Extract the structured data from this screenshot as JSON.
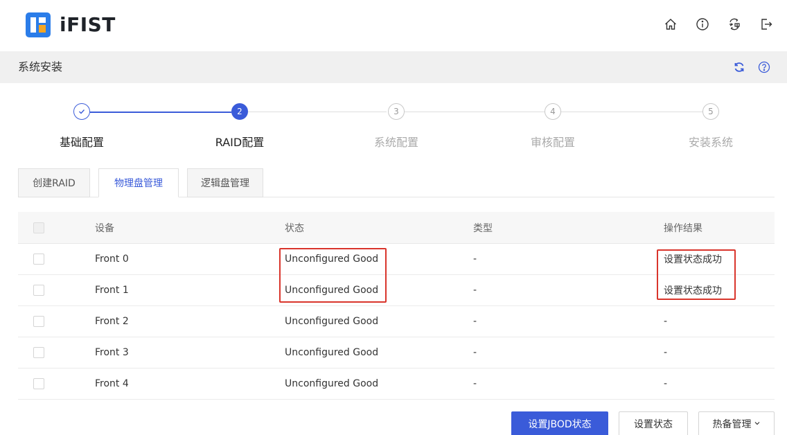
{
  "app": {
    "brand": "iFIST"
  },
  "header": {
    "icons": [
      "home-icon",
      "info-icon",
      "language-switch-icon",
      "logout-icon"
    ]
  },
  "page": {
    "title": "系统安装",
    "toolbar_icons": [
      "refresh-icon",
      "help-icon"
    ]
  },
  "steps": [
    {
      "number": "",
      "label": "基础配置",
      "status": "done"
    },
    {
      "number": "2",
      "label": "RAID配置",
      "status": "current"
    },
    {
      "number": "3",
      "label": "系统配置",
      "status": "pending"
    },
    {
      "number": "4",
      "label": "审核配置",
      "status": "pending"
    },
    {
      "number": "5",
      "label": "安装系统",
      "status": "pending"
    }
  ],
  "tabs": [
    {
      "label": "创建RAID",
      "active": false
    },
    {
      "label": "物理盘管理",
      "active": true
    },
    {
      "label": "逻辑盘管理",
      "active": false
    }
  ],
  "table": {
    "headers": {
      "device": "设备",
      "state": "状态",
      "type": "类型",
      "result": "操作结果"
    },
    "rows": [
      {
        "device": "Front 0",
        "state": "Unconfigured Good",
        "type": "-",
        "result": "设置状态成功"
      },
      {
        "device": "Front 1",
        "state": "Unconfigured Good",
        "type": "-",
        "result": "设置状态成功"
      },
      {
        "device": "Front 2",
        "state": "Unconfigured Good",
        "type": "-",
        "result": "-"
      },
      {
        "device": "Front 3",
        "state": "Unconfigured Good",
        "type": "-",
        "result": "-"
      },
      {
        "device": "Front 4",
        "state": "Unconfigured Good",
        "type": "-",
        "result": "-"
      }
    ]
  },
  "actions": {
    "set_jbod": "设置JBOD状态",
    "set_state": "设置状态",
    "hot_spare": "热备管理"
  },
  "colors": {
    "accent": "#3a5bd9",
    "highlight": "#d9342b",
    "logo_blue": "#2b7de9",
    "logo_orange": "#f5a623"
  }
}
